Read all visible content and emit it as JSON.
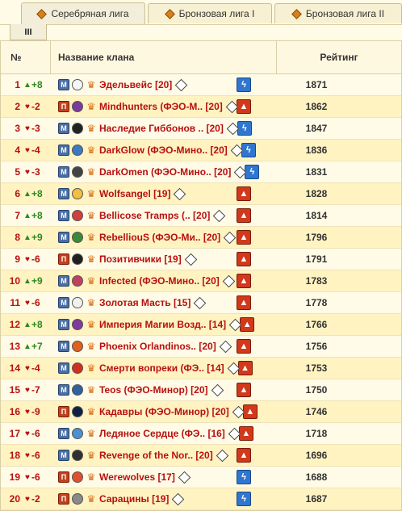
{
  "tabs": [
    {
      "label": "Серебряная лига",
      "icon": "league-diamond-icon",
      "active": true
    },
    {
      "label": "Бронзовая лига I",
      "icon": "league-diamond-icon",
      "active": false
    },
    {
      "label": "Бронзовая лига II",
      "icon": "league-diamond-icon",
      "active": false
    }
  ],
  "subtab": "III",
  "headers": {
    "num": "№",
    "name": "Название клана",
    "rating": "Рейтинг"
  },
  "rows": [
    {
      "pos": "1",
      "dir": "up",
      "chg": "+8",
      "faction": "М",
      "name": "Эдельвейс [20]",
      "side": "light",
      "rating": "1871"
    },
    {
      "pos": "2",
      "dir": "down",
      "chg": "-2",
      "faction": "П",
      "name": "Mindhunters (ФЭО-М.. [20]",
      "side": "fire",
      "rating": "1862"
    },
    {
      "pos": "3",
      "dir": "down",
      "chg": "-3",
      "faction": "М",
      "name": "Наследие Гиббонов .. [20]",
      "side": "light",
      "rating": "1847"
    },
    {
      "pos": "4",
      "dir": "down",
      "chg": "-4",
      "faction": "М",
      "name": "DarkGlow (ФЭО-Мино.. [20]",
      "side": "light",
      "rating": "1836"
    },
    {
      "pos": "5",
      "dir": "down",
      "chg": "-3",
      "faction": "М",
      "name": "DarkOmen (ФЭО-Мино.. [20]",
      "side": "light",
      "rating": "1831"
    },
    {
      "pos": "6",
      "dir": "up",
      "chg": "+8",
      "faction": "М",
      "name": "Wolfsangel [19]",
      "side": "fire",
      "rating": "1828"
    },
    {
      "pos": "7",
      "dir": "up",
      "chg": "+8",
      "faction": "М",
      "name": "Bellicose Tramps (.. [20]",
      "side": "fire",
      "rating": "1814"
    },
    {
      "pos": "8",
      "dir": "up",
      "chg": "+9",
      "faction": "М",
      "name": "RebelliouS (ФЭО-Ми.. [20]",
      "side": "fire",
      "rating": "1796"
    },
    {
      "pos": "9",
      "dir": "down",
      "chg": "-6",
      "faction": "П",
      "name": "Позитивчики [19]",
      "side": "fire",
      "rating": "1791"
    },
    {
      "pos": "10",
      "dir": "up",
      "chg": "+9",
      "faction": "М",
      "name": "Infected (ФЭО-Мино.. [20]",
      "side": "fire",
      "rating": "1783"
    },
    {
      "pos": "11",
      "dir": "down",
      "chg": "-6",
      "faction": "М",
      "name": "Золотая Масть [15]",
      "side": "fire",
      "rating": "1778"
    },
    {
      "pos": "12",
      "dir": "up",
      "chg": "+8",
      "faction": "М",
      "name": "Империя Магии Возд.. [14]",
      "side": "fire",
      "rating": "1766"
    },
    {
      "pos": "13",
      "dir": "up",
      "chg": "+7",
      "faction": "М",
      "name": "Phoenix Orlandinos.. [20]",
      "side": "fire",
      "rating": "1756"
    },
    {
      "pos": "14",
      "dir": "down",
      "chg": "-4",
      "faction": "М",
      "name": "Смерти вопреки (ФЭ.. [14]",
      "side": "fire",
      "rating": "1753"
    },
    {
      "pos": "15",
      "dir": "down",
      "chg": "-7",
      "faction": "М",
      "name": "Teos (ФЭО-Минор) [20]",
      "side": "fire",
      "rating": "1750"
    },
    {
      "pos": "16",
      "dir": "down",
      "chg": "-9",
      "faction": "П",
      "name": "Кадавры (ФЭО-Минор) [20]",
      "side": "fire",
      "rating": "1746"
    },
    {
      "pos": "17",
      "dir": "down",
      "chg": "-6",
      "faction": "М",
      "name": "Ледяное Сердце (ФЭ.. [16]",
      "side": "fire",
      "rating": "1718"
    },
    {
      "pos": "18",
      "dir": "down",
      "chg": "-6",
      "faction": "М",
      "name": "Revenge of the Nor.. [20]",
      "side": "fire",
      "rating": "1696"
    },
    {
      "pos": "19",
      "dir": "down",
      "chg": "-6",
      "faction": "П",
      "name": "Werewolves [17]",
      "side": "light",
      "rating": "1688"
    },
    {
      "pos": "20",
      "dir": "down",
      "chg": "-2",
      "faction": "П",
      "name": "Сарацины [19]",
      "side": "light",
      "rating": "1687"
    }
  ]
}
